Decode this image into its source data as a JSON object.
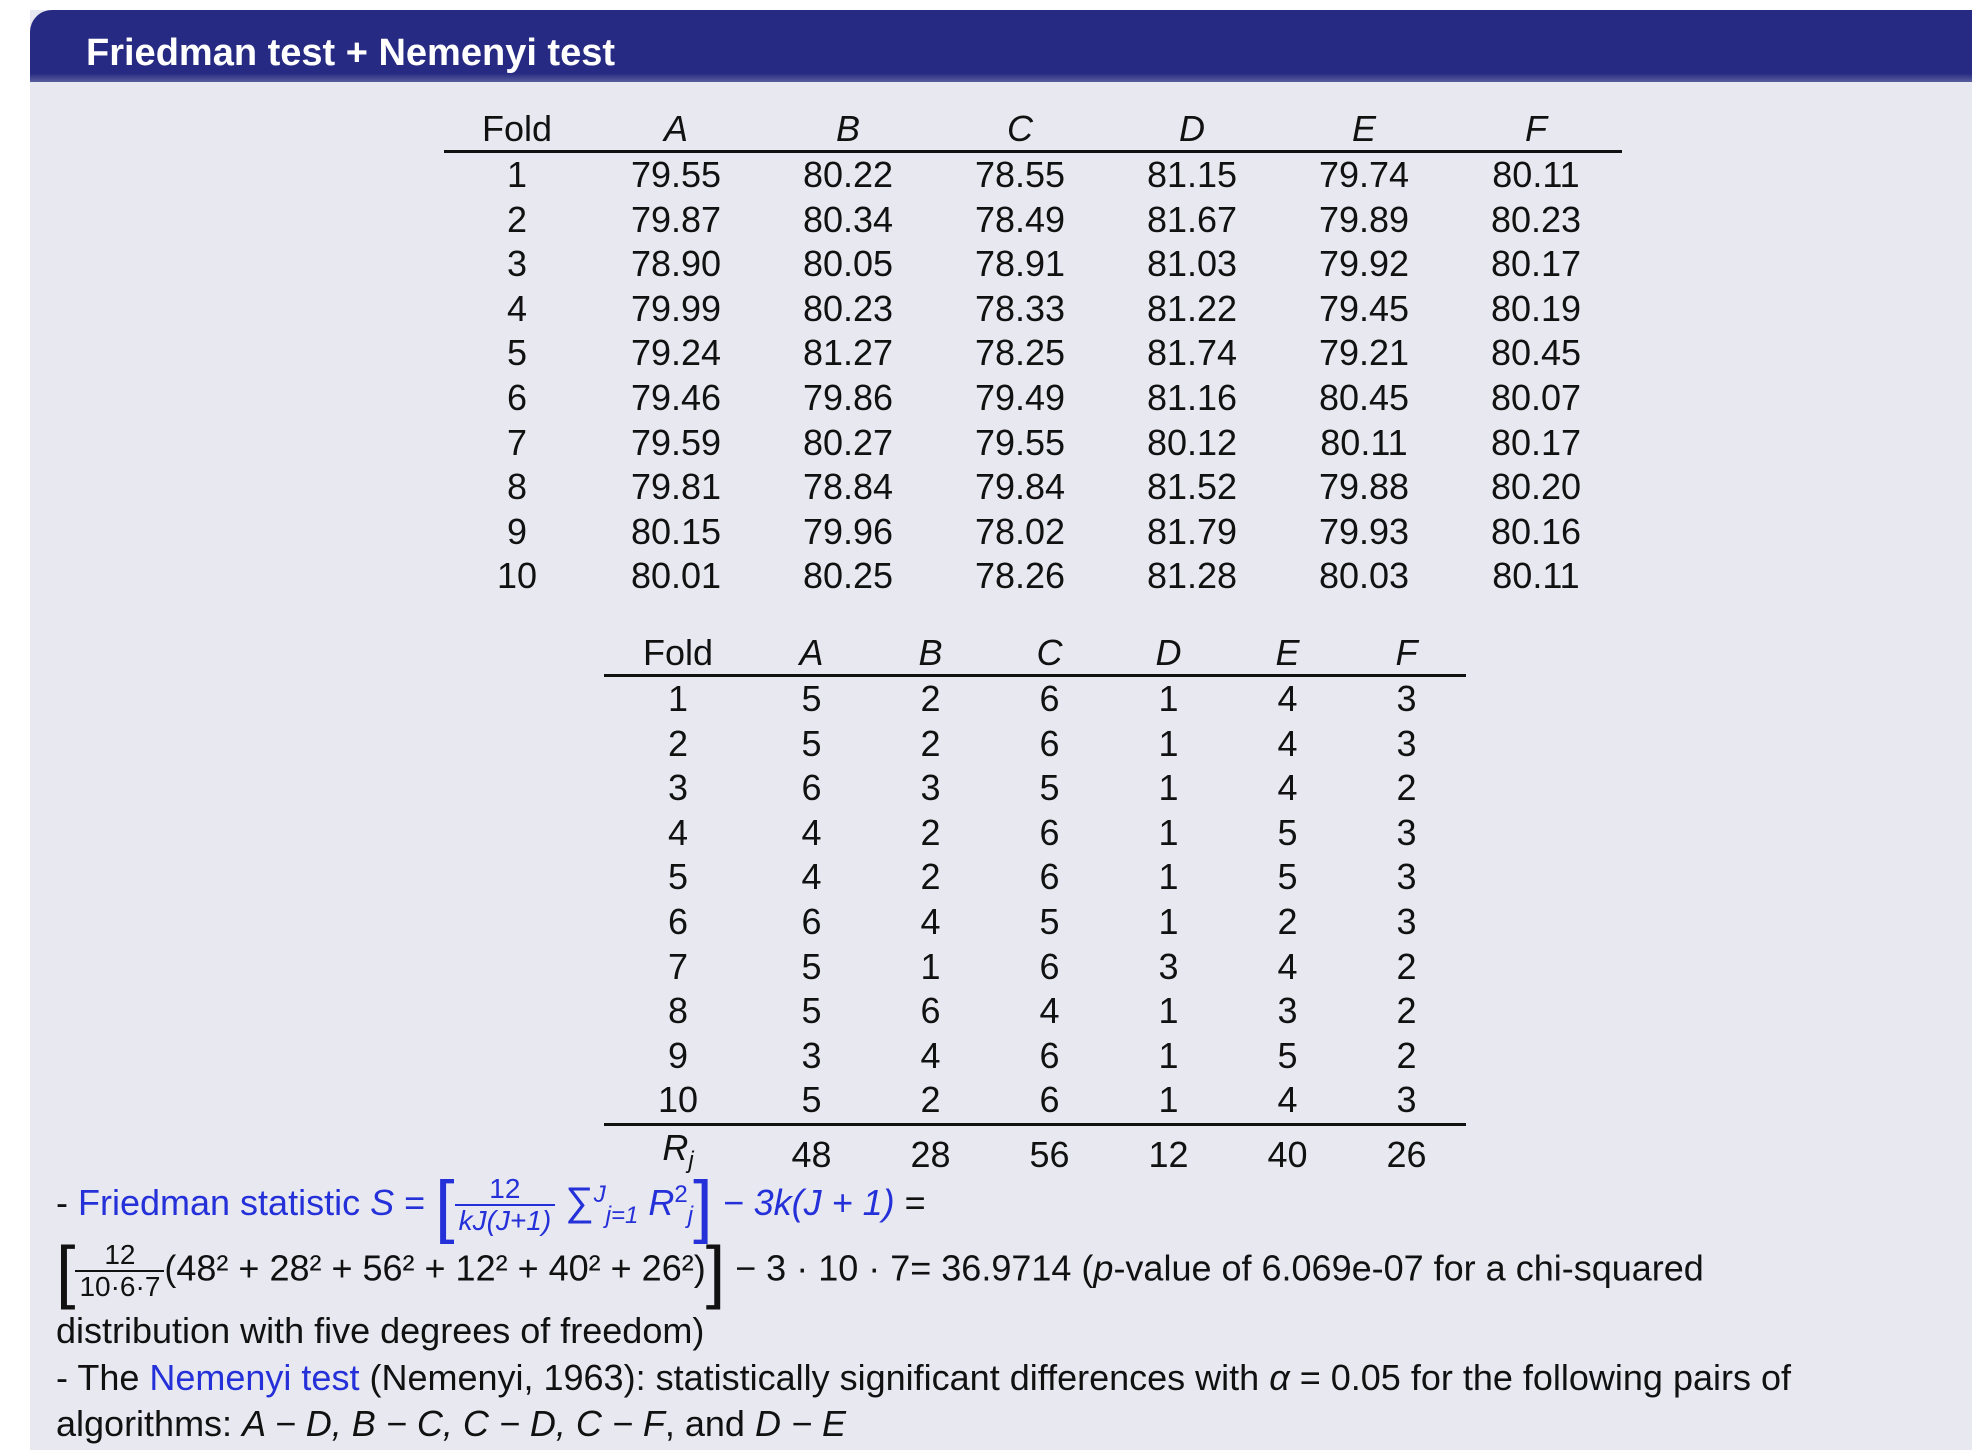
{
  "header": {
    "title": "Friedman test + Nemenyi test"
  },
  "table1": {
    "columns": [
      "Fold",
      "A",
      "B",
      "C",
      "D",
      "E",
      "F"
    ],
    "rows": [
      [
        "1",
        "79.55",
        "80.22",
        "78.55",
        "81.15",
        "79.74",
        "80.11"
      ],
      [
        "2",
        "79.87",
        "80.34",
        "78.49",
        "81.67",
        "79.89",
        "80.23"
      ],
      [
        "3",
        "78.90",
        "80.05",
        "78.91",
        "81.03",
        "79.92",
        "80.17"
      ],
      [
        "4",
        "79.99",
        "80.23",
        "78.33",
        "81.22",
        "79.45",
        "80.19"
      ],
      [
        "5",
        "79.24",
        "81.27",
        "78.25",
        "81.74",
        "79.21",
        "80.45"
      ],
      [
        "6",
        "79.46",
        "79.86",
        "79.49",
        "81.16",
        "80.45",
        "80.07"
      ],
      [
        "7",
        "79.59",
        "80.27",
        "79.55",
        "80.12",
        "80.11",
        "80.17"
      ],
      [
        "8",
        "79.81",
        "78.84",
        "79.84",
        "81.52",
        "79.88",
        "80.20"
      ],
      [
        "9",
        "80.15",
        "79.96",
        "78.02",
        "81.79",
        "79.93",
        "80.16"
      ],
      [
        "10",
        "80.01",
        "80.25",
        "78.26",
        "81.28",
        "80.03",
        "80.11"
      ]
    ]
  },
  "table2": {
    "columns": [
      "Fold",
      "A",
      "B",
      "C",
      "D",
      "E",
      "F"
    ],
    "rows": [
      [
        "1",
        "5",
        "2",
        "6",
        "1",
        "4",
        "3"
      ],
      [
        "2",
        "5",
        "2",
        "6",
        "1",
        "4",
        "3"
      ],
      [
        "3",
        "6",
        "3",
        "5",
        "1",
        "4",
        "2"
      ],
      [
        "4",
        "4",
        "2",
        "6",
        "1",
        "5",
        "3"
      ],
      [
        "5",
        "4",
        "2",
        "6",
        "1",
        "5",
        "3"
      ],
      [
        "6",
        "6",
        "4",
        "5",
        "1",
        "2",
        "3"
      ],
      [
        "7",
        "5",
        "1",
        "6",
        "3",
        "4",
        "2"
      ],
      [
        "8",
        "5",
        "6",
        "4",
        "1",
        "3",
        "2"
      ],
      [
        "9",
        "3",
        "4",
        "6",
        "1",
        "5",
        "2"
      ],
      [
        "10",
        "5",
        "2",
        "6",
        "1",
        "4",
        "3"
      ]
    ],
    "sum_label": "R",
    "sum_label_sub": "j",
    "sums": [
      "48",
      "28",
      "56",
      "12",
      "40",
      "26"
    ]
  },
  "text": {
    "dash1": "- ",
    "friedman_link": "Friedman statistic",
    "S": "S",
    "eq": " = ",
    "twelve": "12",
    "kJ": "kJ(J+1)",
    "sum_sym": "∑",
    "sum_upper": "J",
    "sum_lower": "j=1",
    "R": "R",
    "R_sup": "2",
    "R_sub": "j",
    "minus3k": " − 3k(J + 1)",
    "equals_tail": " =",
    "den2": "10·6·7",
    "expr": "(48² + 28² + 56² + 12² + 40² + 26²)",
    "after_bracket": " − 3 · 10 · 7= 36.9714 (",
    "p_it": "p",
    "p_rest": "-value of 6.069e-07 for a chi-squared",
    "line3": "distribution with five degrees of freedom)",
    "dash2": "- The ",
    "nemenyi_link": "Nemenyi test",
    "nemenyi_rest": " (Nemenyi, 1963): statistically significant differences with ",
    "alpha": "α",
    "alpha_rest": " = 0.05 for the following pairs of",
    "pairs_prefix": "algorithms: ",
    "pairs": "A − D, B − C, C − D, C − F",
    "pairs_and": ", and ",
    "last_pair": "D − E"
  }
}
